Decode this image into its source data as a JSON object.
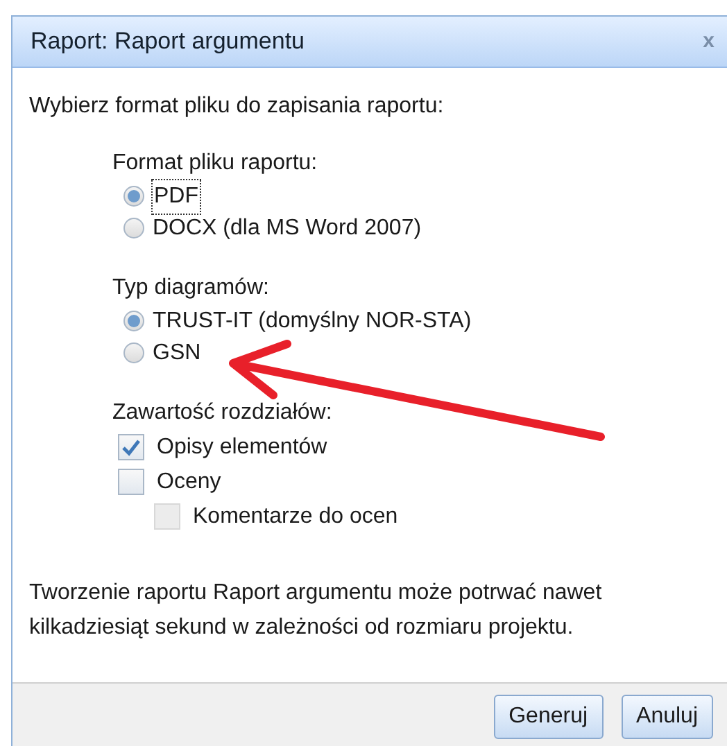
{
  "window": {
    "title": "Raport: Raport argumentu",
    "close": "x"
  },
  "intro": "Wybierz format pliku do zapisania raportu:",
  "groups": [
    {
      "label": "Format pliku raportu:",
      "kind": "radio",
      "options": [
        {
          "label": "PDF",
          "selected": true,
          "focused": true
        },
        {
          "label": "DOCX (dla MS Word 2007)",
          "selected": false,
          "focused": false
        }
      ]
    },
    {
      "label": "Typ diagramów:",
      "kind": "radio",
      "options": [
        {
          "label": "TRUST-IT (domyślny NOR-STA)",
          "selected": true,
          "focused": false
        },
        {
          "label": "GSN",
          "selected": false,
          "focused": false
        }
      ]
    },
    {
      "label": "Zawartość rozdziałów:",
      "kind": "checkbox",
      "options": [
        {
          "label": "Opisy elementów",
          "checked": true,
          "disabled": false
        },
        {
          "label": "Oceny",
          "checked": false,
          "disabled": false,
          "children": [
            {
              "label": "Komentarze do ocen",
              "checked": false,
              "disabled": true
            }
          ]
        }
      ]
    }
  ],
  "note": "Tworzenie raportu Raport argumentu może potrwać nawet kilkadziesiąt sekund w zależności od rozmiaru projektu.",
  "buttons": [
    "Generuj",
    "Anuluj"
  ]
}
